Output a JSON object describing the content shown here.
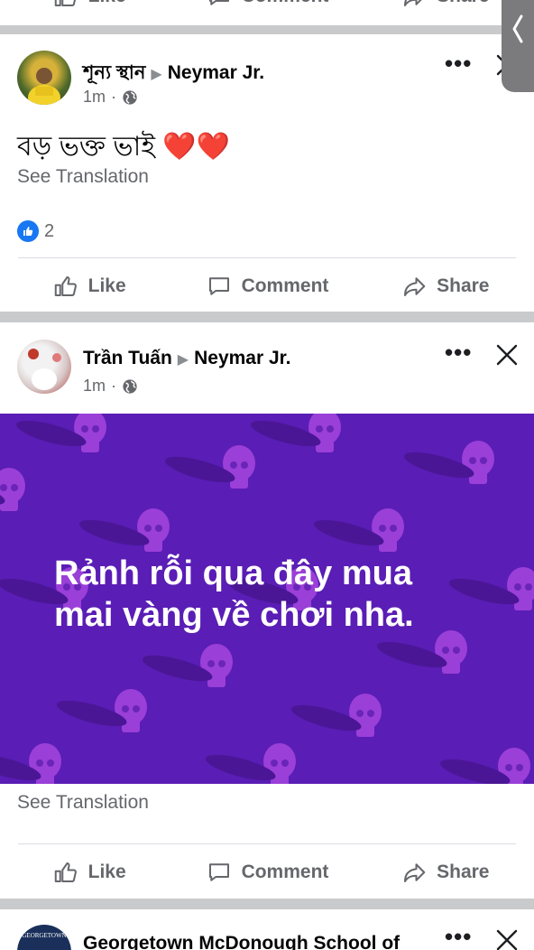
{
  "top_card": {
    "like_label": "Like",
    "comment_label": "Comment",
    "share_label": "Share"
  },
  "post1": {
    "author": "শূন্য স্থান",
    "target": "Neymar Jr.",
    "time": "1m",
    "body": "বড় ভক্ত ভাই ❤️❤️",
    "see_translation": "See Translation",
    "reaction_count": "2",
    "like_label": "Like",
    "comment_label": "Comment",
    "share_label": "Share"
  },
  "post2": {
    "author": "Trần Tuấn",
    "target": "Neymar Jr.",
    "time": "1m",
    "body_line1": "Rảnh rỗi qua đây mua",
    "body_line2": "mai vàng về chơi nha.",
    "see_translation": "See Translation",
    "like_label": "Like",
    "comment_label": "Comment",
    "share_label": "Share",
    "background_color": "#5a1db5"
  },
  "post3": {
    "author": "Georgetown McDonough School of",
    "avatar_text": "GEORGETOWN"
  },
  "colors": {
    "like_blue": "#1877f2",
    "heart_red": "#e41e3f",
    "muted_text": "#65676b"
  },
  "icons": {
    "globe": "globe-icon",
    "like": "thumbs-up-icon",
    "comment": "comment-icon",
    "share": "share-icon",
    "more": "more-icon",
    "close": "close-icon",
    "tab": "chevron-left-icon"
  }
}
